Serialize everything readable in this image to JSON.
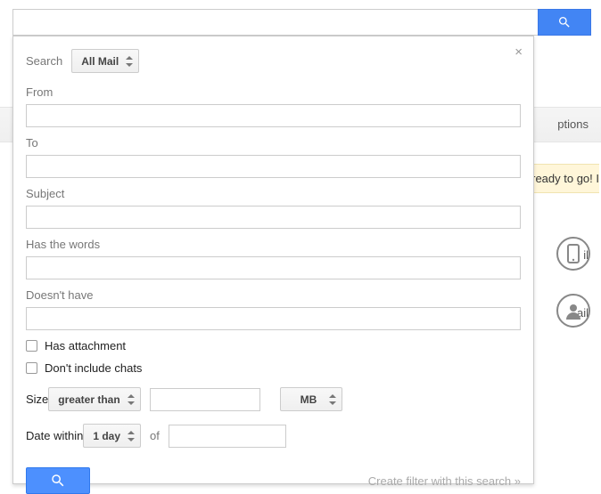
{
  "topSearch": {
    "value": ""
  },
  "adv": {
    "close": "×",
    "searchLabel": "Search",
    "searchScope": "All Mail",
    "fromLabel": "From",
    "from": "",
    "toLabel": "To",
    "to": "",
    "subjectLabel": "Subject",
    "subject": "",
    "hasWordsLabel": "Has the words",
    "hasWords": "",
    "doesntHaveLabel": "Doesn't have",
    "doesntHave": "",
    "hasAttachmentLabel": "Has attachment",
    "dontIncludeChatsLabel": "Don't include chats",
    "sizeLabel": "Size",
    "sizeOperator": "greater than",
    "sizeValue": "",
    "sizeUnit": "MB",
    "dateWithinLabel": "Date within",
    "dateWithinValue": "1 day",
    "ofLabel": "of",
    "dateValue": "",
    "createFilterLabel": "Create filter with this search »"
  },
  "bg": {
    "options": "ptions",
    "ready": "ready to go! I",
    "frag1": "il",
    "frag2": "ail"
  }
}
